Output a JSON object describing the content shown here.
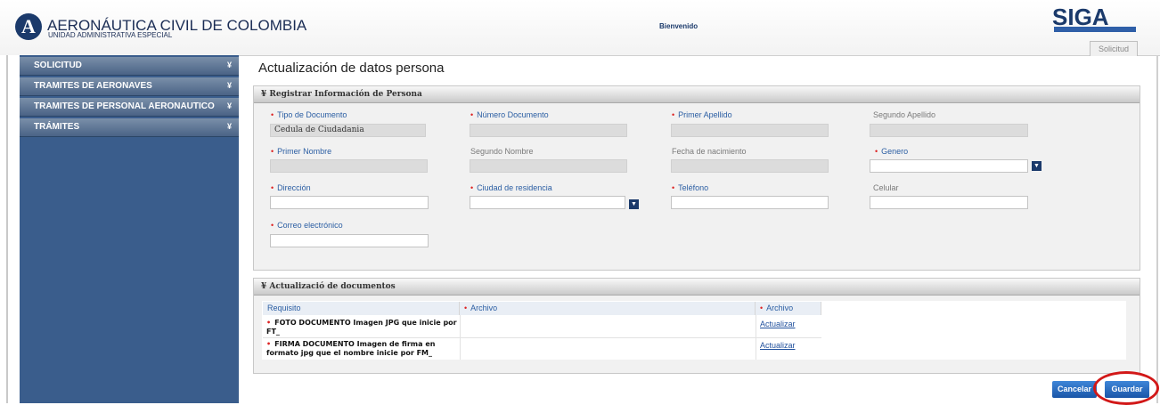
{
  "header": {
    "logo_letter": "A",
    "org_name": "AERONÁUTICA CIVIL DE COLOMBIA",
    "org_sub": "UNIDAD ADMINISTRATIVA ESPECIAL",
    "welcome": "Bienvenido",
    "app_logo": "SIGA",
    "tab_label": "Solicitud"
  },
  "sidebar": {
    "items": [
      {
        "label": "SOLICITUD"
      },
      {
        "label": "TRAMITES DE AERONAVES"
      },
      {
        "label": "TRAMITES DE PERSONAL AERONAUTICO"
      },
      {
        "label": "TRÁMITES"
      }
    ],
    "chevron": "¥"
  },
  "main": {
    "title": "Actualización de datos persona",
    "panel1": {
      "header": "Registrar Información de Persona",
      "fields": {
        "tipo_documento": {
          "label": "Tipo de Documento",
          "value": "Cedula de Ciudadania"
        },
        "numero_documento": {
          "label": "Número Documento",
          "value": ""
        },
        "primer_apellido": {
          "label": "Primer Apellido",
          "value": ""
        },
        "segundo_apellido": {
          "label": "Segundo Apellido",
          "value": ""
        },
        "primer_nombre": {
          "label": "Primer Nombre",
          "value": ""
        },
        "segundo_nombre": {
          "label": "Segundo Nombre",
          "value": ""
        },
        "fecha_nacimiento": {
          "label": "Fecha de nacimiento",
          "value": ""
        },
        "genero": {
          "label": "Genero",
          "value": ""
        },
        "direccion": {
          "label": "Dirección",
          "value": ""
        },
        "ciudad": {
          "label": "Ciudad de residencia",
          "value": ""
        },
        "telefono": {
          "label": "Teléfono",
          "value": ""
        },
        "celular": {
          "label": "Celular",
          "value": ""
        },
        "correo": {
          "label": "Correo electrónico",
          "value": ""
        }
      }
    },
    "panel2": {
      "header": "Actualizació de documentos",
      "columns": [
        "Requisito",
        "Archivo",
        "Archivo"
      ],
      "rows": [
        {
          "requisito": "FOTO DOCUMENTO Imagen JPG que inicie por FT_",
          "archivo": "",
          "action": "Actualizar"
        },
        {
          "requisito": "FIRMA DOCUMENTO Imagen de firma en formato jpg que el nombre inicie por FM_",
          "archivo": "",
          "action": "Actualizar"
        }
      ]
    }
  },
  "buttons": {
    "cancel": "Cancelar",
    "save": "Guardar"
  },
  "colors": {
    "sidebar": "#3a5d8c",
    "accent": "#1b3a6b",
    "required": "#dd2222",
    "highlight": "#d21818"
  }
}
